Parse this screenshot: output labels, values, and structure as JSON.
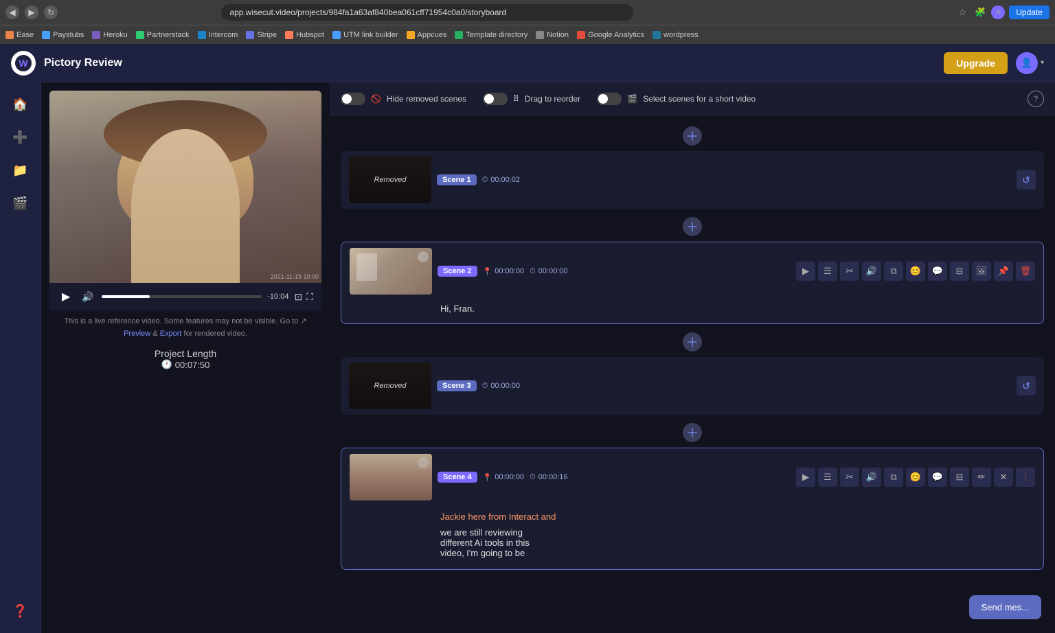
{
  "browser": {
    "url": "app.wisecut.video/projects/984fa1a63af840bea061cff71954c0a0/storyboard",
    "update_btn": "Update",
    "bookmarks": [
      {
        "label": "Ease",
        "color": "#e8834a"
      },
      {
        "label": "Paystubs",
        "color": "#4a9eff"
      },
      {
        "label": "Heroku",
        "color": "#7c5cbf"
      },
      {
        "label": "Partnerstack",
        "color": "#2ecc71"
      },
      {
        "label": "Intercom",
        "color": "#1984c8"
      },
      {
        "label": "Stripe",
        "color": "#6772e5"
      },
      {
        "label": "Hubspot",
        "color": "#ff7a59"
      },
      {
        "label": "UTM link builder",
        "color": "#4a9eff"
      },
      {
        "label": "Appcues",
        "color": "#f6a623"
      },
      {
        "label": "Template directory",
        "color": "#27ae60"
      },
      {
        "label": "Notion",
        "color": "#888"
      },
      {
        "label": "Google Analytics",
        "color": "#e74c3c"
      },
      {
        "label": "wordpress",
        "color": "#21759b"
      }
    ]
  },
  "header": {
    "logo_text": "W",
    "title": "Pictory Review",
    "upgrade_btn": "Upgrade",
    "avatar_initials": "👤"
  },
  "sidebar": {
    "items": [
      {
        "icon": "🏠",
        "label": "Home"
      },
      {
        "icon": "➕",
        "label": "Add"
      },
      {
        "icon": "📁",
        "label": "Folder"
      },
      {
        "icon": "🎬",
        "label": "Media"
      },
      {
        "icon": "❓",
        "label": "Help"
      }
    ]
  },
  "video_panel": {
    "info_text": "This is a live reference video. Some features may not be visible. Go to",
    "info_link1": "Preview",
    "info_link2": "Export",
    "info_text2": "for rendered video.",
    "project_length_label": "Project Length",
    "project_length_value": "00:07:50",
    "time_remaining": "-10:04",
    "play_icon": "▶",
    "volume_icon": "🔊"
  },
  "toolbar": {
    "hide_removed_label": "Hide removed scenes",
    "drag_reorder_label": "Drag to reorder",
    "select_short_label": "Select scenes for a short video",
    "help": "?"
  },
  "scenes": [
    {
      "id": "scene-1",
      "badge": "Scene 1",
      "duration": "00:00:02",
      "removed": true,
      "transcript": ""
    },
    {
      "id": "scene-2",
      "badge": "Scene 2",
      "position": "00:00:00",
      "duration": "00:00:00",
      "removed": false,
      "transcript": "Hi, Fran.",
      "active": true
    },
    {
      "id": "scene-3",
      "badge": "Scene 3",
      "duration": "00:00:00",
      "removed": true,
      "transcript": ""
    },
    {
      "id": "scene-4",
      "badge": "Scene 4",
      "position": "00:00:00",
      "duration": "00:00:16",
      "removed": false,
      "transcript_highlight": "Jackie here from Interact and",
      "transcript_rest": "we are still reviewing\ndifferent Ai tools in this\nvideo, I'm going to be",
      "active": false
    }
  ],
  "send_message_btn": "Send mes...",
  "removed_label": "Removed"
}
